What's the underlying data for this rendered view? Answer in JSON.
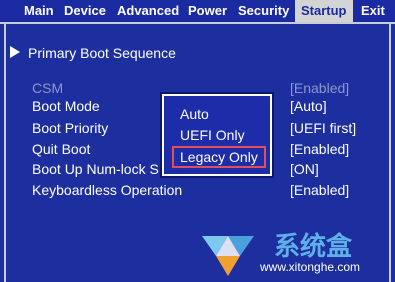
{
  "menu": {
    "items": [
      {
        "label": "Main"
      },
      {
        "label": "Device"
      },
      {
        "label": "Advanced"
      },
      {
        "label": "Power"
      },
      {
        "label": "Security"
      },
      {
        "label": "Startup"
      },
      {
        "label": "Exit"
      }
    ],
    "active": "Startup"
  },
  "startup": {
    "section_title": "Primary Boot Sequence",
    "settings": [
      {
        "label": "CSM",
        "value": "[Enabled]"
      },
      {
        "label": "Boot Mode",
        "value": "[Auto]"
      },
      {
        "label": "Boot Priority",
        "value": "[UEFI first]"
      },
      {
        "label": "Quit Boot",
        "value": "[Enabled]"
      },
      {
        "label": "Boot Up Num-lock S",
        "value": "[ON]"
      },
      {
        "label": "Keyboardless Operation",
        "value": "[Enabled]"
      }
    ]
  },
  "popup": {
    "options": [
      "Auto",
      "UEFI Only",
      "Legacy Only"
    ],
    "selected": "Legacy Only"
  },
  "watermark": {
    "brand": "系统盒",
    "url": "www.xitonghe.com"
  },
  "colors": {
    "background": "#1d2f9e",
    "menu_active_bg": "#d4d4d4",
    "highlight_border": "#e0505a",
    "watermark": "#5fb0e8"
  }
}
